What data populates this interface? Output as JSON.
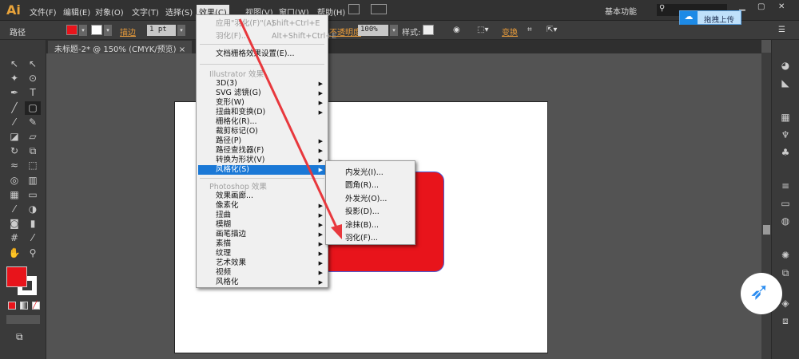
{
  "app": {
    "logo": "Ai",
    "workspace": "基本功能",
    "search_icon": "search-icon"
  },
  "menubar": [
    "文件(F)",
    "编辑(E)",
    "对象(O)",
    "文字(T)",
    "选择(S)",
    "效果(C)",
    "视图(V)",
    "窗口(W)",
    "帮助(H)"
  ],
  "control": {
    "label": "路径",
    "stroke_label": "描边",
    "stroke_value": "1 pt",
    "opacity_label": "不透明度",
    "opacity_value": "100%",
    "style_label": "样式:",
    "transform_label": "变换",
    "fill_color": "#e8141b"
  },
  "document_tab": {
    "title": "未标题-2* @ 150% (CMYK/预览)",
    "close": "×"
  },
  "effect_menu": {
    "top": [
      {
        "label": "应用\"羽化(F)\"(A)",
        "shortcut": "Shift+Ctrl+E"
      },
      {
        "label": "羽化(F)...",
        "shortcut": "Alt+Shift+Ctrl+E"
      }
    ],
    "doc_raster": "文档栅格效果设置(E)...",
    "illustrator_header": "Illustrator 效果",
    "illustrator_items": [
      {
        "label": "3D(3)",
        "sub": true
      },
      {
        "label": "SVG 滤镜(G)",
        "sub": true
      },
      {
        "label": "变形(W)",
        "sub": true
      },
      {
        "label": "扭曲和变换(D)",
        "sub": true
      },
      {
        "label": "栅格化(R)...",
        "sub": false
      },
      {
        "label": "裁剪标记(O)",
        "sub": false
      },
      {
        "label": "路径(P)",
        "sub": true
      },
      {
        "label": "路径查找器(F)",
        "sub": true
      },
      {
        "label": "转换为形状(V)",
        "sub": true
      },
      {
        "label": "风格化(S)",
        "sub": true,
        "highlighted": true
      }
    ],
    "photoshop_header": "Photoshop 效果",
    "photoshop_items": [
      {
        "label": "效果画廊...",
        "sub": false
      },
      {
        "label": "像素化",
        "sub": true
      },
      {
        "label": "扭曲",
        "sub": true
      },
      {
        "label": "模糊",
        "sub": true
      },
      {
        "label": "画笔描边",
        "sub": true
      },
      {
        "label": "素描",
        "sub": true
      },
      {
        "label": "纹理",
        "sub": true
      },
      {
        "label": "艺术效果",
        "sub": true
      },
      {
        "label": "视频",
        "sub": true
      },
      {
        "label": "风格化",
        "sub": true
      }
    ]
  },
  "stylize_submenu": [
    "内发光(I)...",
    "圆角(R)...",
    "外发光(O)...",
    "投影(D)...",
    "涂抹(B)...",
    "羽化(F)..."
  ],
  "upload_button": "拖拽上传",
  "tools": [
    [
      "selection",
      "↖"
    ],
    [
      "direct-selection",
      "↖"
    ],
    [
      "magic-wand",
      "✦"
    ],
    [
      "lasso",
      "⊙"
    ],
    [
      "pen",
      "✒"
    ],
    [
      "type",
      "T"
    ],
    [
      "line",
      "╱"
    ],
    [
      "rounded-rectangle",
      "▢"
    ],
    [
      "paintbrush",
      "⁄"
    ],
    [
      "pencil",
      "✎"
    ],
    [
      "blob-brush",
      "◪"
    ],
    [
      "eraser",
      "▱"
    ],
    [
      "rotate",
      "↻"
    ],
    [
      "scale",
      "⧉"
    ],
    [
      "warp",
      "≈"
    ],
    [
      "free-transform",
      "⬚"
    ],
    [
      "shape-builder",
      "◎"
    ],
    [
      "graph-perspective",
      "▥"
    ],
    [
      "mesh",
      "▦"
    ],
    [
      "gradient",
      "▭"
    ],
    [
      "eyedropper",
      "⁄"
    ],
    [
      "blend",
      "◑"
    ],
    [
      "symbol-sprayer",
      "◙"
    ],
    [
      "column-graph",
      "▮"
    ],
    [
      "artboard",
      "#"
    ],
    [
      "slice",
      "⁄"
    ],
    [
      "hand",
      "✋"
    ],
    [
      "zoom",
      "⚲"
    ]
  ],
  "panels": [
    [
      "color",
      "◕"
    ],
    [
      "color-guide",
      "◣"
    ],
    [
      "swatches",
      "▦"
    ],
    [
      "brushes",
      "♆"
    ],
    [
      "symbols",
      "♣"
    ],
    [
      "stroke",
      "≡"
    ],
    [
      "gradient",
      "▭"
    ],
    [
      "transparency",
      "◍"
    ],
    [
      "appearance",
      "✺"
    ],
    [
      "graphic-styles",
      "⧉"
    ],
    [
      "layers",
      "◈"
    ],
    [
      "artboards",
      "⧈"
    ]
  ],
  "colors": {
    "accent": "#1a78d6",
    "arrow": "#e8383d",
    "fill": "#e8141b"
  }
}
